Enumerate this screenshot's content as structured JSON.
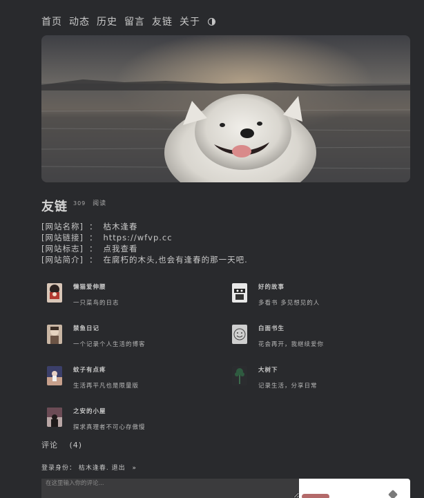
{
  "nav": {
    "items": [
      "首页",
      "动态",
      "历史",
      "留言",
      "友链",
      "关于"
    ],
    "theme_toggle_icon": "half-circle-icon"
  },
  "post": {
    "title": "友链",
    "read_count": "309",
    "read_label": "阅读"
  },
  "info": [
    {
      "key": "[网站名称]",
      "sep": "：",
      "value": "枯木逢春"
    },
    {
      "key": "[网站链接]",
      "sep": "：",
      "value": "https://wfvp.cc"
    },
    {
      "key": "[网站标志]",
      "sep": "：",
      "value": "点我查看"
    },
    {
      "key": "[网站简介]",
      "sep": "：",
      "value": "在腐朽的木头,也会有逢春的那一天吧."
    }
  ],
  "friends": [
    {
      "name": "懒猫爱伸腰",
      "desc": "一只菜鸟的日志"
    },
    {
      "name": "好的故事",
      "desc": "多看书  多见想见的人"
    },
    {
      "name": "禁鱼日记",
      "desc": "一个记录个人生活的博客"
    },
    {
      "name": "白面书生",
      "desc": "花会再开，我继续爱你"
    },
    {
      "name": "蚊子有点疼",
      "desc": "生活再平凡也是限量版"
    },
    {
      "name": "大树下",
      "desc": "记录生活，分享日常"
    },
    {
      "name": "之安的小屋",
      "desc": "探求真理者不可心存傲慢"
    }
  ],
  "comments": {
    "label": "评论",
    "count": "(4)",
    "login_prefix": "登录身份：",
    "login_user": "枯木逢春",
    "login_sep": ".",
    "logout": "退出",
    "arrow": "»",
    "placeholder": "在这里输入你的评论..."
  },
  "colors": {
    "background": "#292a2d",
    "text": "#c8c8c8"
  }
}
